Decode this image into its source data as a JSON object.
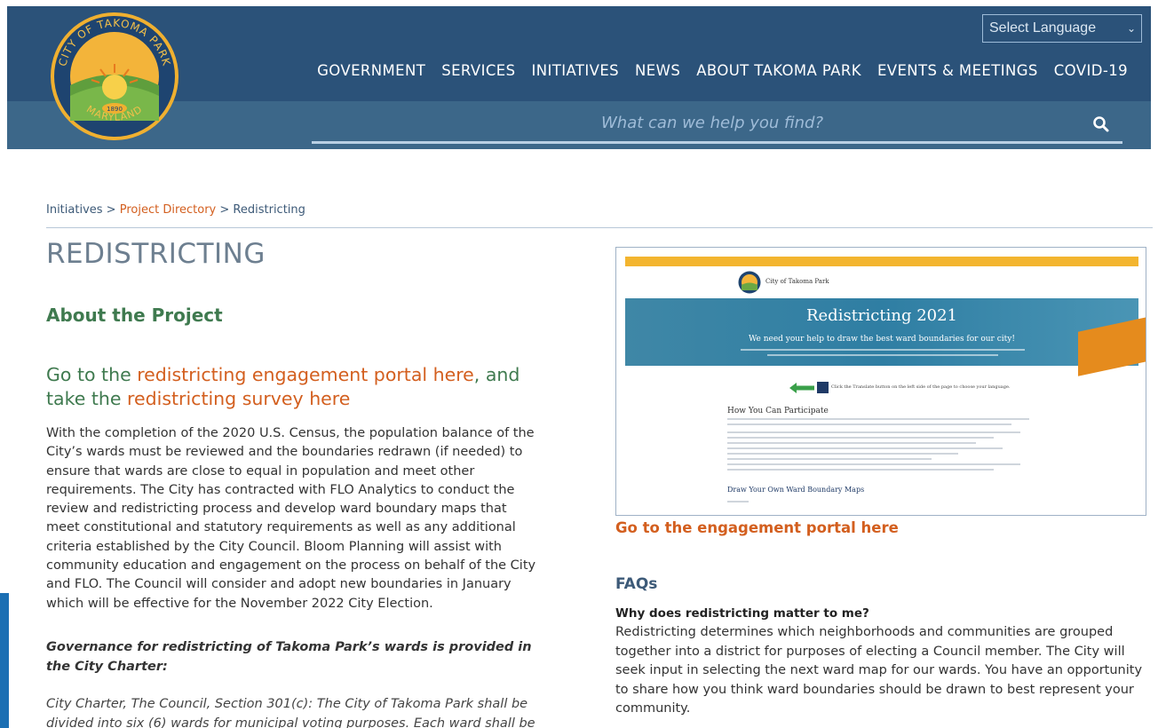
{
  "header": {
    "logo": {
      "top_text": "CITY OF TAKOMA PARK",
      "bottom_text": "MARYLAND",
      "year": "1890"
    },
    "language_select": {
      "value": "Select Language"
    },
    "nav": [
      "GOVERNMENT",
      "SERVICES",
      "INITIATIVES",
      "NEWS",
      "ABOUT TAKOMA PARK",
      "EVENTS & MEETINGS",
      "COVID-19"
    ],
    "search": {
      "placeholder": "What can we help you find?"
    }
  },
  "breadcrumb": {
    "items": [
      "Initiatives",
      "Project Directory",
      "Redistricting"
    ],
    "separator": " > "
  },
  "main": {
    "title": "REDISTRICTING",
    "about_heading": "About the Project",
    "goto": {
      "part1": "Go to the ",
      "link1": "redistricting engagement portal here",
      "part2": ", and take the ",
      "link2": "redistricting survey here"
    },
    "body": "With the completion of the 2020 U.S. Census, the population balance of the City’s wards must be reviewed and the boundaries redrawn (if needed) to ensure that wards are close to equal in population and meet other requirements. The City has contracted with FLO Analytics to conduct the review and redistricting process and develop ward boundary maps that meet constitutional and statutory requirements as well as any additional criteria established by the City Council. Bloom Planning will assist with community education and engagement on the process on behalf of the City and FLO. The Council will consider and adopt new boundaries in January which will be effective for the November 2022 City Election.",
    "governance": "Governance for redistricting of Takoma Park’s wards is provided in the City Charter:",
    "charter": "City Charter, The Council, Section 301(c): The City of Takoma Park shall be divided into six (6) wards for municipal voting purposes. Each ward shall be"
  },
  "preview": {
    "site_name": "City of Takoma Park",
    "banner_title": "Redistricting 2021",
    "banner_subtitle": "We need your help to draw the best ward boundaries for our city!",
    "translate_note": "Click the Translate button on the left side of the page to choose your language.",
    "how_heading": "How You Can Participate",
    "draw_heading": "Draw Your Own Ward Boundary Maps"
  },
  "portal_link": "Go to the engagement portal here",
  "faqs": {
    "heading": "FAQs",
    "items": [
      {
        "question": "Why does redistricting matter to me?",
        "answer": "Redistricting determines which neighborhoods and communities are grouped together into a district for purposes of electing a Council member. The City will seek input in selecting the next ward map for our wards. You have an opportunity to share how you think ward boundaries should be drawn to best represent your community."
      }
    ]
  },
  "colors": {
    "header_dark": "#2b5279",
    "header_light": "#3c6789",
    "accent_orange": "#d35f1f",
    "heading_green": "#3f7a4f",
    "title_gray": "#6d7f90"
  }
}
